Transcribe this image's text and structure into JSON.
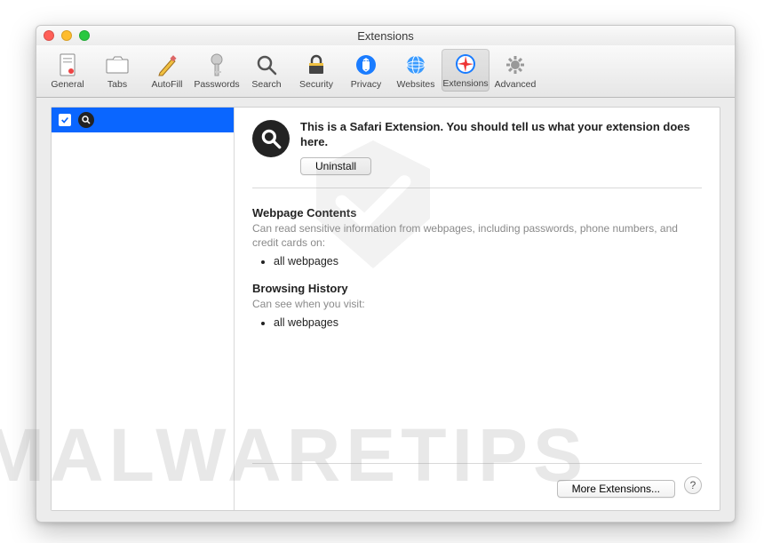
{
  "window": {
    "title": "Extensions"
  },
  "watermark": "MALWARETIPS",
  "toolbar": {
    "items": [
      {
        "label": "General"
      },
      {
        "label": "Tabs"
      },
      {
        "label": "AutoFill"
      },
      {
        "label": "Passwords"
      },
      {
        "label": "Search"
      },
      {
        "label": "Security"
      },
      {
        "label": "Privacy"
      },
      {
        "label": "Websites"
      },
      {
        "label": "Extensions"
      },
      {
        "label": "Advanced"
      }
    ]
  },
  "ext_detail": {
    "description": "This is a Safari Extension. You should tell us what your extension does here.",
    "uninstall_label": "Uninstall"
  },
  "permissions": {
    "section1_title": "Webpage Contents",
    "section1_sub": "Can read sensitive information from webpages, including passwords, phone numbers, and credit cards on:",
    "section1_item": "all webpages",
    "section2_title": "Browsing History",
    "section2_sub": "Can see when you visit:",
    "section2_item": "all webpages"
  },
  "footer": {
    "more_label": "More Extensions...",
    "help_label": "?"
  }
}
